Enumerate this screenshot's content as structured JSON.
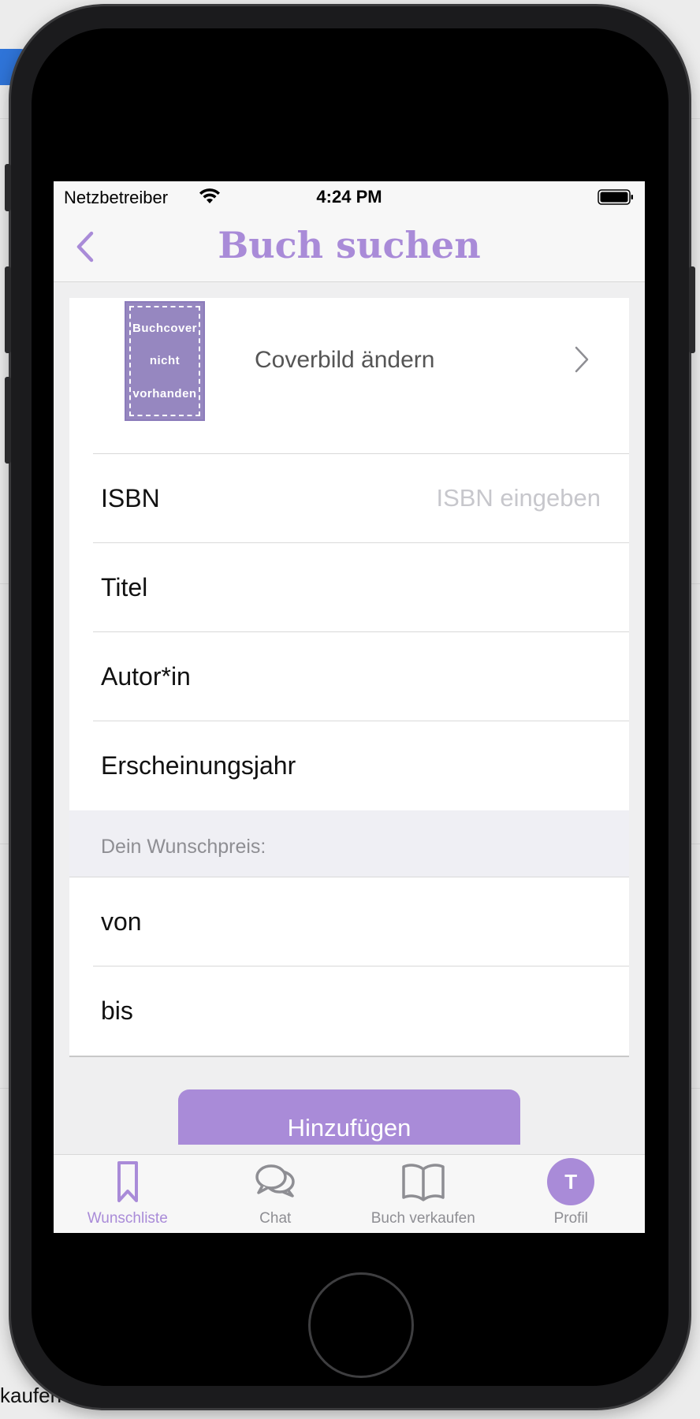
{
  "status_bar": {
    "carrier": "Netzbetreiber",
    "time": "4:24 PM"
  },
  "nav": {
    "title": "Buch suchen"
  },
  "cover": {
    "placeholder_lines": [
      "Buchcover",
      "nicht",
      "vorhanden"
    ],
    "change_label": "Coverbild ändern"
  },
  "fields": [
    {
      "label": "ISBN",
      "placeholder": "ISBN eingeben"
    },
    {
      "label": "Titel",
      "placeholder": ""
    },
    {
      "label": "Autor*in",
      "placeholder": ""
    },
    {
      "label": "Erscheinungsjahr",
      "placeholder": ""
    }
  ],
  "price_section": {
    "header": "Dein Wunschpreis:",
    "fields": [
      {
        "label": "von",
        "placeholder": ""
      },
      {
        "label": "bis",
        "placeholder": ""
      }
    ]
  },
  "add_button_label": "Hinzufügen",
  "tabs": [
    {
      "label": "Wunschliste",
      "icon": "bookmark-icon",
      "active": true
    },
    {
      "label": "Chat",
      "icon": "chat-icon",
      "active": false
    },
    {
      "label": "Buch verkaufen",
      "icon": "book-icon",
      "active": false
    },
    {
      "label": "Profil",
      "icon": "avatar",
      "active": false,
      "avatar_initial": "T"
    }
  ],
  "background_app": {
    "bottom_text": "kaufen"
  },
  "colors": {
    "accent": "#a98bd8",
    "cover_placeholder": "#9687c0",
    "inactive_tab": "#8e8e93"
  }
}
